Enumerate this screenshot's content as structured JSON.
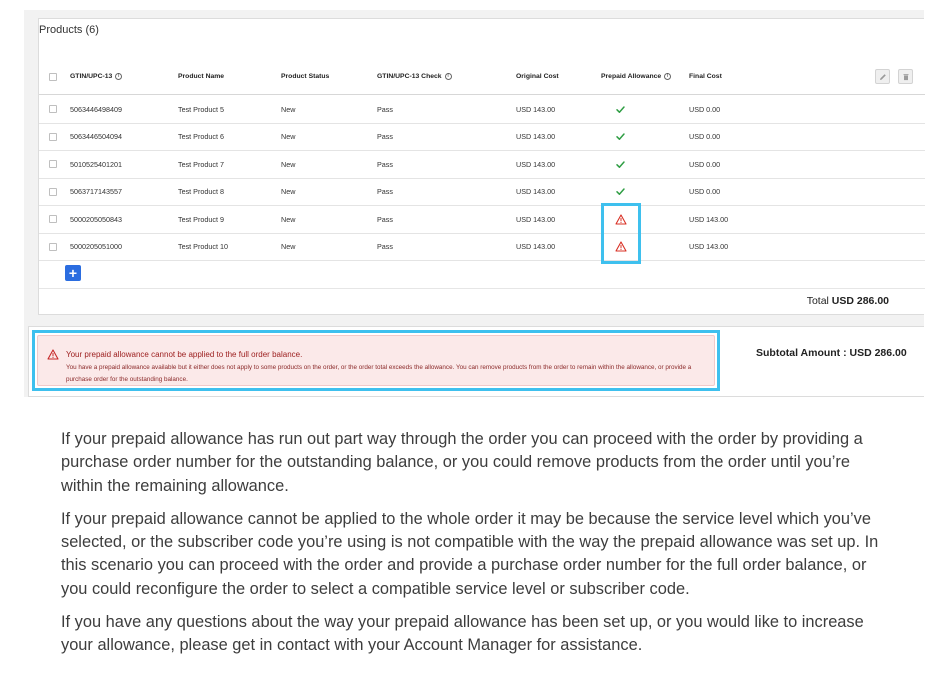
{
  "products_panel": {
    "title": "Products (6)",
    "columns": [
      {
        "label": "GTIN/UPC-13",
        "info": true
      },
      {
        "label": "Product Name",
        "info": false
      },
      {
        "label": "Product Status",
        "info": false
      },
      {
        "label": "GTIN/UPC-13 Check",
        "info": true
      },
      {
        "label": "Original Cost",
        "info": false
      },
      {
        "label": "Prepaid Allowance",
        "info": true
      },
      {
        "label": "Final Cost",
        "info": false
      }
    ],
    "rows": [
      {
        "gtin": "5063446498409",
        "name": "Test Product 5",
        "status": "New",
        "check": "Pass",
        "original_cost": "USD 143.00",
        "allowance": "check-icon",
        "final_cost": "USD 0.00"
      },
      {
        "gtin": "5063446504094",
        "name": "Test Product 6",
        "status": "New",
        "check": "Pass",
        "original_cost": "USD 143.00",
        "allowance": "check-icon",
        "final_cost": "USD 0.00"
      },
      {
        "gtin": "5010525401201",
        "name": "Test Product 7",
        "status": "New",
        "check": "Pass",
        "original_cost": "USD 143.00",
        "allowance": "check-icon",
        "final_cost": "USD 0.00"
      },
      {
        "gtin": "5063717143557",
        "name": "Test Product 8",
        "status": "New",
        "check": "Pass",
        "original_cost": "USD 143.00",
        "allowance": "check-icon",
        "final_cost": "USD 0.00"
      },
      {
        "gtin": "5000205050843",
        "name": "Test Product 9",
        "status": "New",
        "check": "Pass",
        "original_cost": "USD 143.00",
        "allowance": "warning-icon",
        "final_cost": "USD 143.00"
      },
      {
        "gtin": "5000205051000",
        "name": "Test Product 10",
        "status": "New",
        "check": "Pass",
        "original_cost": "USD 143.00",
        "allowance": "warning-icon",
        "final_cost": "USD 143.00"
      }
    ],
    "add_label": "+",
    "total_label": "Total",
    "total_value": "USD 286.00"
  },
  "alert": {
    "title": "Your prepaid allowance cannot be applied to the full order balance.",
    "body": "You have a prepaid allowance available but it either does not apply to some products on the order, or the order total exceeds the allowance. You can remove products from the order to remain within the allowance, or provide a purchase order for the outstanding balance."
  },
  "subtotal": "Subtotal Amount : USD 286.00",
  "paragraphs": [
    "If your prepaid allowance has run out part way through the order you can proceed with the order by providing a purchase order number for the outstanding balance, or you could remove products from the order until you’re within the remaining allowance.",
    "If your prepaid allowance cannot be applied to the whole order it may be because the service level which you’ve selected, or the subscriber code you’re using is not compatible with the way the prepaid allowance was set up. In this scenario you can proceed with the order and provide a purchase order number for the full order balance, or you could reconfigure the order to select a compatible service level or subscriber code.",
    "If you have any questions about the way your prepaid allowance has been set up, or you would like to increase your allowance, please get in contact with your Account Manager for assistance."
  ],
  "colors": {
    "check": "#2f9e44",
    "warning": "#d93025",
    "highlight": "#3ec0ee",
    "accent": "#2b6de0"
  }
}
